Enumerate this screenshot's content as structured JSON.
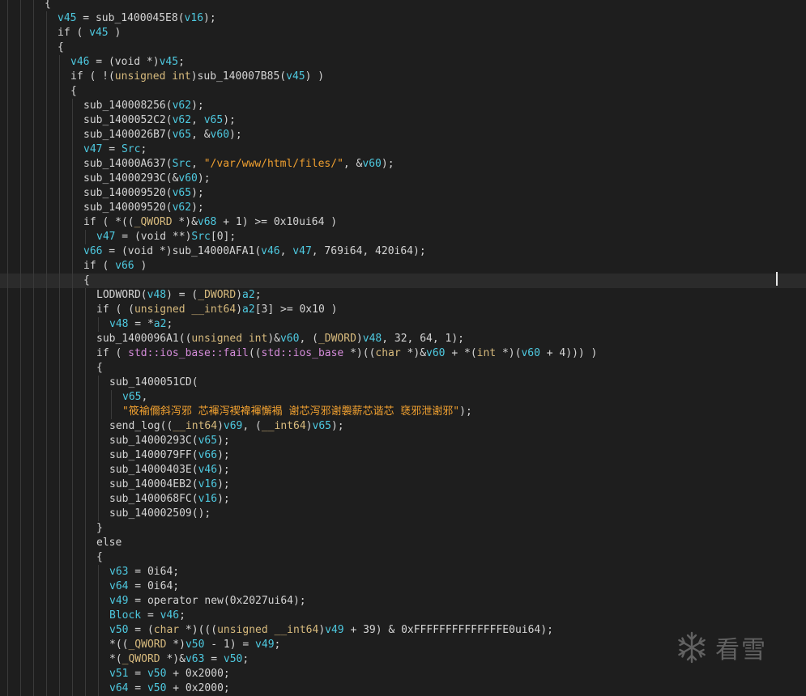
{
  "theme": {
    "background": "#1e1e1e",
    "current_line_background": "#2b2b2b",
    "colors": {
      "p": "#d4d4d4",
      "v": "#4ec9e0",
      "kw": "#dcdcaa",
      "t": "#d7ba7d",
      "s": "#f0a030",
      "q": "#d48bd9"
    }
  },
  "code_lines": [
    {
      "indent": 3,
      "tokens": [
        [
          "p",
          "{"
        ]
      ]
    },
    {
      "indent": 4,
      "tokens": [
        [
          "v",
          "v45"
        ],
        [
          "p",
          " = sub_1400045E8("
        ],
        [
          "v",
          "v16"
        ],
        [
          "p",
          ");"
        ]
      ]
    },
    {
      "indent": 4,
      "tokens": [
        [
          "p",
          "if ( "
        ],
        [
          "v",
          "v45"
        ],
        [
          "p",
          " )"
        ]
      ]
    },
    {
      "indent": 4,
      "tokens": [
        [
          "p",
          "{"
        ]
      ]
    },
    {
      "indent": 5,
      "tokens": [
        [
          "v",
          "v46"
        ],
        [
          "p",
          " = (void *)"
        ],
        [
          "v",
          "v45"
        ],
        [
          "p",
          ";"
        ]
      ]
    },
    {
      "indent": 5,
      "tokens": [
        [
          "p",
          "if ( !("
        ],
        [
          "t",
          "unsigned int"
        ],
        [
          "p",
          ")sub_140007B85("
        ],
        [
          "v",
          "v45"
        ],
        [
          "p",
          ") )"
        ]
      ]
    },
    {
      "indent": 5,
      "tokens": [
        [
          "p",
          "{"
        ]
      ]
    },
    {
      "indent": 6,
      "tokens": [
        [
          "p",
          "sub_140008256("
        ],
        [
          "v",
          "v62"
        ],
        [
          "p",
          ");"
        ]
      ]
    },
    {
      "indent": 6,
      "tokens": [
        [
          "p",
          "sub_1400052C2("
        ],
        [
          "v",
          "v62"
        ],
        [
          "p",
          ", "
        ],
        [
          "v",
          "v65"
        ],
        [
          "p",
          ");"
        ]
      ]
    },
    {
      "indent": 6,
      "tokens": [
        [
          "p",
          "sub_1400026B7("
        ],
        [
          "v",
          "v65"
        ],
        [
          "p",
          ", &"
        ],
        [
          "v",
          "v60"
        ],
        [
          "p",
          ");"
        ]
      ]
    },
    {
      "indent": 6,
      "tokens": [
        [
          "v",
          "v47"
        ],
        [
          "p",
          " = "
        ],
        [
          "v",
          "Src"
        ],
        [
          "p",
          ";"
        ]
      ]
    },
    {
      "indent": 6,
      "tokens": [
        [
          "p",
          "sub_14000A637("
        ],
        [
          "v",
          "Src"
        ],
        [
          "p",
          ", "
        ],
        [
          "s",
          "\"/var/www/html/files/\""
        ],
        [
          "p",
          ", &"
        ],
        [
          "v",
          "v60"
        ],
        [
          "p",
          ");"
        ]
      ]
    },
    {
      "indent": 6,
      "tokens": [
        [
          "p",
          "sub_14000293C(&"
        ],
        [
          "v",
          "v60"
        ],
        [
          "p",
          ");"
        ]
      ]
    },
    {
      "indent": 6,
      "tokens": [
        [
          "p",
          "sub_140009520("
        ],
        [
          "v",
          "v65"
        ],
        [
          "p",
          ");"
        ]
      ]
    },
    {
      "indent": 6,
      "tokens": [
        [
          "p",
          "sub_140009520("
        ],
        [
          "v",
          "v62"
        ],
        [
          "p",
          ");"
        ]
      ]
    },
    {
      "indent": 6,
      "tokens": [
        [
          "p",
          "if ( *(("
        ],
        [
          "t",
          "_QWORD"
        ],
        [
          "p",
          " *)&"
        ],
        [
          "v",
          "v68"
        ],
        [
          "p",
          " + 1) >= 0x10ui64 )"
        ]
      ]
    },
    {
      "indent": 7,
      "tokens": [
        [
          "v",
          "v47"
        ],
        [
          "p",
          " = (void **)"
        ],
        [
          "v",
          "Src"
        ],
        [
          "p",
          "[0];"
        ]
      ]
    },
    {
      "indent": 6,
      "tokens": [
        [
          "v",
          "v66"
        ],
        [
          "p",
          " = (void *)sub_14000AFA1("
        ],
        [
          "v",
          "v46"
        ],
        [
          "p",
          ", "
        ],
        [
          "v",
          "v47"
        ],
        [
          "p",
          ", 769i64, 420i64);"
        ]
      ]
    },
    {
      "indent": 6,
      "tokens": [
        [
          "p",
          "if ( "
        ],
        [
          "v",
          "v66"
        ],
        [
          "p",
          " )"
        ]
      ]
    },
    {
      "indent": 6,
      "tokens": [
        [
          "p",
          "{"
        ]
      ],
      "hl": true
    },
    {
      "indent": 7,
      "tokens": [
        [
          "p",
          "LODWORD("
        ],
        [
          "v",
          "v48"
        ],
        [
          "p",
          ") = ("
        ],
        [
          "t",
          "_DWORD"
        ],
        [
          "p",
          ")"
        ],
        [
          "v",
          "a2"
        ],
        [
          "p",
          ";"
        ]
      ]
    },
    {
      "indent": 7,
      "tokens": [
        [
          "p",
          "if ( ("
        ],
        [
          "t",
          "unsigned __int64"
        ],
        [
          "p",
          ")"
        ],
        [
          "v",
          "a2"
        ],
        [
          "p",
          "[3] >= 0x10 )"
        ]
      ]
    },
    {
      "indent": 8,
      "tokens": [
        [
          "v",
          "v48"
        ],
        [
          "p",
          " = *"
        ],
        [
          "v",
          "a2"
        ],
        [
          "p",
          ";"
        ]
      ]
    },
    {
      "indent": 7,
      "tokens": [
        [
          "p",
          "sub_1400096A1(("
        ],
        [
          "t",
          "unsigned int"
        ],
        [
          "p",
          ")&"
        ],
        [
          "v",
          "v60"
        ],
        [
          "p",
          ", ("
        ],
        [
          "t",
          "_DWORD"
        ],
        [
          "p",
          ")"
        ],
        [
          "v",
          "v48"
        ],
        [
          "p",
          ", 32, 64, 1);"
        ]
      ]
    },
    {
      "indent": 7,
      "tokens": [
        [
          "p",
          "if ( "
        ],
        [
          "q",
          "std::ios_base::fail"
        ],
        [
          "p",
          "(("
        ],
        [
          "q",
          "std::ios_base"
        ],
        [
          "p",
          " *)(("
        ],
        [
          "t",
          "char"
        ],
        [
          "p",
          " *)&"
        ],
        [
          "v",
          "v60"
        ],
        [
          "p",
          " + *("
        ],
        [
          "t",
          "int"
        ],
        [
          "p",
          " *)("
        ],
        [
          "v",
          "v60"
        ],
        [
          "p",
          " + 4))) )"
        ]
      ]
    },
    {
      "indent": 7,
      "tokens": [
        [
          "p",
          "{"
        ]
      ]
    },
    {
      "indent": 8,
      "tokens": [
        [
          "p",
          "sub_1400051CD("
        ]
      ]
    },
    {
      "indent": 9,
      "tokens": [
        [
          "v",
          "v65"
        ],
        [
          "p",
          ","
        ]
      ]
    },
    {
      "indent": 9,
      "tokens": [
        [
          "s",
          "\"筱褕儞斜泻邪 芯褌泻褉褘褌懈褟 谢芯泻邪谢褜薪芯谐芯 褎邪泄谢邪\""
        ],
        [
          "p",
          ");"
        ]
      ]
    },
    {
      "indent": 8,
      "tokens": [
        [
          "p",
          "send_log(("
        ],
        [
          "t",
          "__int64"
        ],
        [
          "p",
          ")"
        ],
        [
          "v",
          "v69"
        ],
        [
          "p",
          ", ("
        ],
        [
          "t",
          "__int64"
        ],
        [
          "p",
          ")"
        ],
        [
          "v",
          "v65"
        ],
        [
          "p",
          ");"
        ]
      ]
    },
    {
      "indent": 8,
      "tokens": [
        [
          "p",
          "sub_14000293C("
        ],
        [
          "v",
          "v65"
        ],
        [
          "p",
          ");"
        ]
      ]
    },
    {
      "indent": 8,
      "tokens": [
        [
          "p",
          "sub_1400079FF("
        ],
        [
          "v",
          "v66"
        ],
        [
          "p",
          ");"
        ]
      ]
    },
    {
      "indent": 8,
      "tokens": [
        [
          "p",
          "sub_14000403E("
        ],
        [
          "v",
          "v46"
        ],
        [
          "p",
          ");"
        ]
      ]
    },
    {
      "indent": 8,
      "tokens": [
        [
          "p",
          "sub_140004EB2("
        ],
        [
          "v",
          "v16"
        ],
        [
          "p",
          ");"
        ]
      ]
    },
    {
      "indent": 8,
      "tokens": [
        [
          "p",
          "sub_1400068FC("
        ],
        [
          "v",
          "v16"
        ],
        [
          "p",
          ");"
        ]
      ]
    },
    {
      "indent": 8,
      "tokens": [
        [
          "p",
          "sub_140002509();"
        ]
      ]
    },
    {
      "indent": 7,
      "tokens": [
        [
          "p",
          "}"
        ]
      ]
    },
    {
      "indent": 7,
      "tokens": [
        [
          "p",
          "else"
        ]
      ]
    },
    {
      "indent": 7,
      "tokens": [
        [
          "p",
          "{"
        ]
      ]
    },
    {
      "indent": 8,
      "tokens": [
        [
          "v",
          "v63"
        ],
        [
          "p",
          " = 0i64;"
        ]
      ]
    },
    {
      "indent": 8,
      "tokens": [
        [
          "v",
          "v64"
        ],
        [
          "p",
          " = 0i64;"
        ]
      ]
    },
    {
      "indent": 8,
      "tokens": [
        [
          "v",
          "v49"
        ],
        [
          "p",
          " = operator new(0x2027ui64);"
        ]
      ]
    },
    {
      "indent": 8,
      "tokens": [
        [
          "v",
          "Block"
        ],
        [
          "p",
          " = "
        ],
        [
          "v",
          "v46"
        ],
        [
          "p",
          ";"
        ]
      ]
    },
    {
      "indent": 8,
      "tokens": [
        [
          "v",
          "v50"
        ],
        [
          "p",
          " = ("
        ],
        [
          "t",
          "char"
        ],
        [
          "p",
          " *)((("
        ],
        [
          "t",
          "unsigned __int64"
        ],
        [
          "p",
          ")"
        ],
        [
          "v",
          "v49"
        ],
        [
          "p",
          " + 39) & 0xFFFFFFFFFFFFFFE0ui64);"
        ]
      ]
    },
    {
      "indent": 8,
      "tokens": [
        [
          "p",
          "*(("
        ],
        [
          "t",
          "_QWORD"
        ],
        [
          "p",
          " *)"
        ],
        [
          "v",
          "v50"
        ],
        [
          "p",
          " - 1) = "
        ],
        [
          "v",
          "v49"
        ],
        [
          "p",
          ";"
        ]
      ]
    },
    {
      "indent": 8,
      "tokens": [
        [
          "p",
          "*("
        ],
        [
          "t",
          "_QWORD"
        ],
        [
          "p",
          " *)&"
        ],
        [
          "v",
          "v63"
        ],
        [
          "p",
          " = "
        ],
        [
          "v",
          "v50"
        ],
        [
          "p",
          ";"
        ]
      ]
    },
    {
      "indent": 8,
      "tokens": [
        [
          "v",
          "v51"
        ],
        [
          "p",
          " = "
        ],
        [
          "v",
          "v50"
        ],
        [
          "p",
          " + 0x2000;"
        ]
      ]
    },
    {
      "indent": 8,
      "tokens": [
        [
          "v",
          "v64"
        ],
        [
          "p",
          " = "
        ],
        [
          "v",
          "v50"
        ],
        [
          "p",
          " + 0x2000;"
        ]
      ]
    }
  ],
  "watermark": {
    "icon": "snowflake-icon",
    "text": "看雪"
  }
}
